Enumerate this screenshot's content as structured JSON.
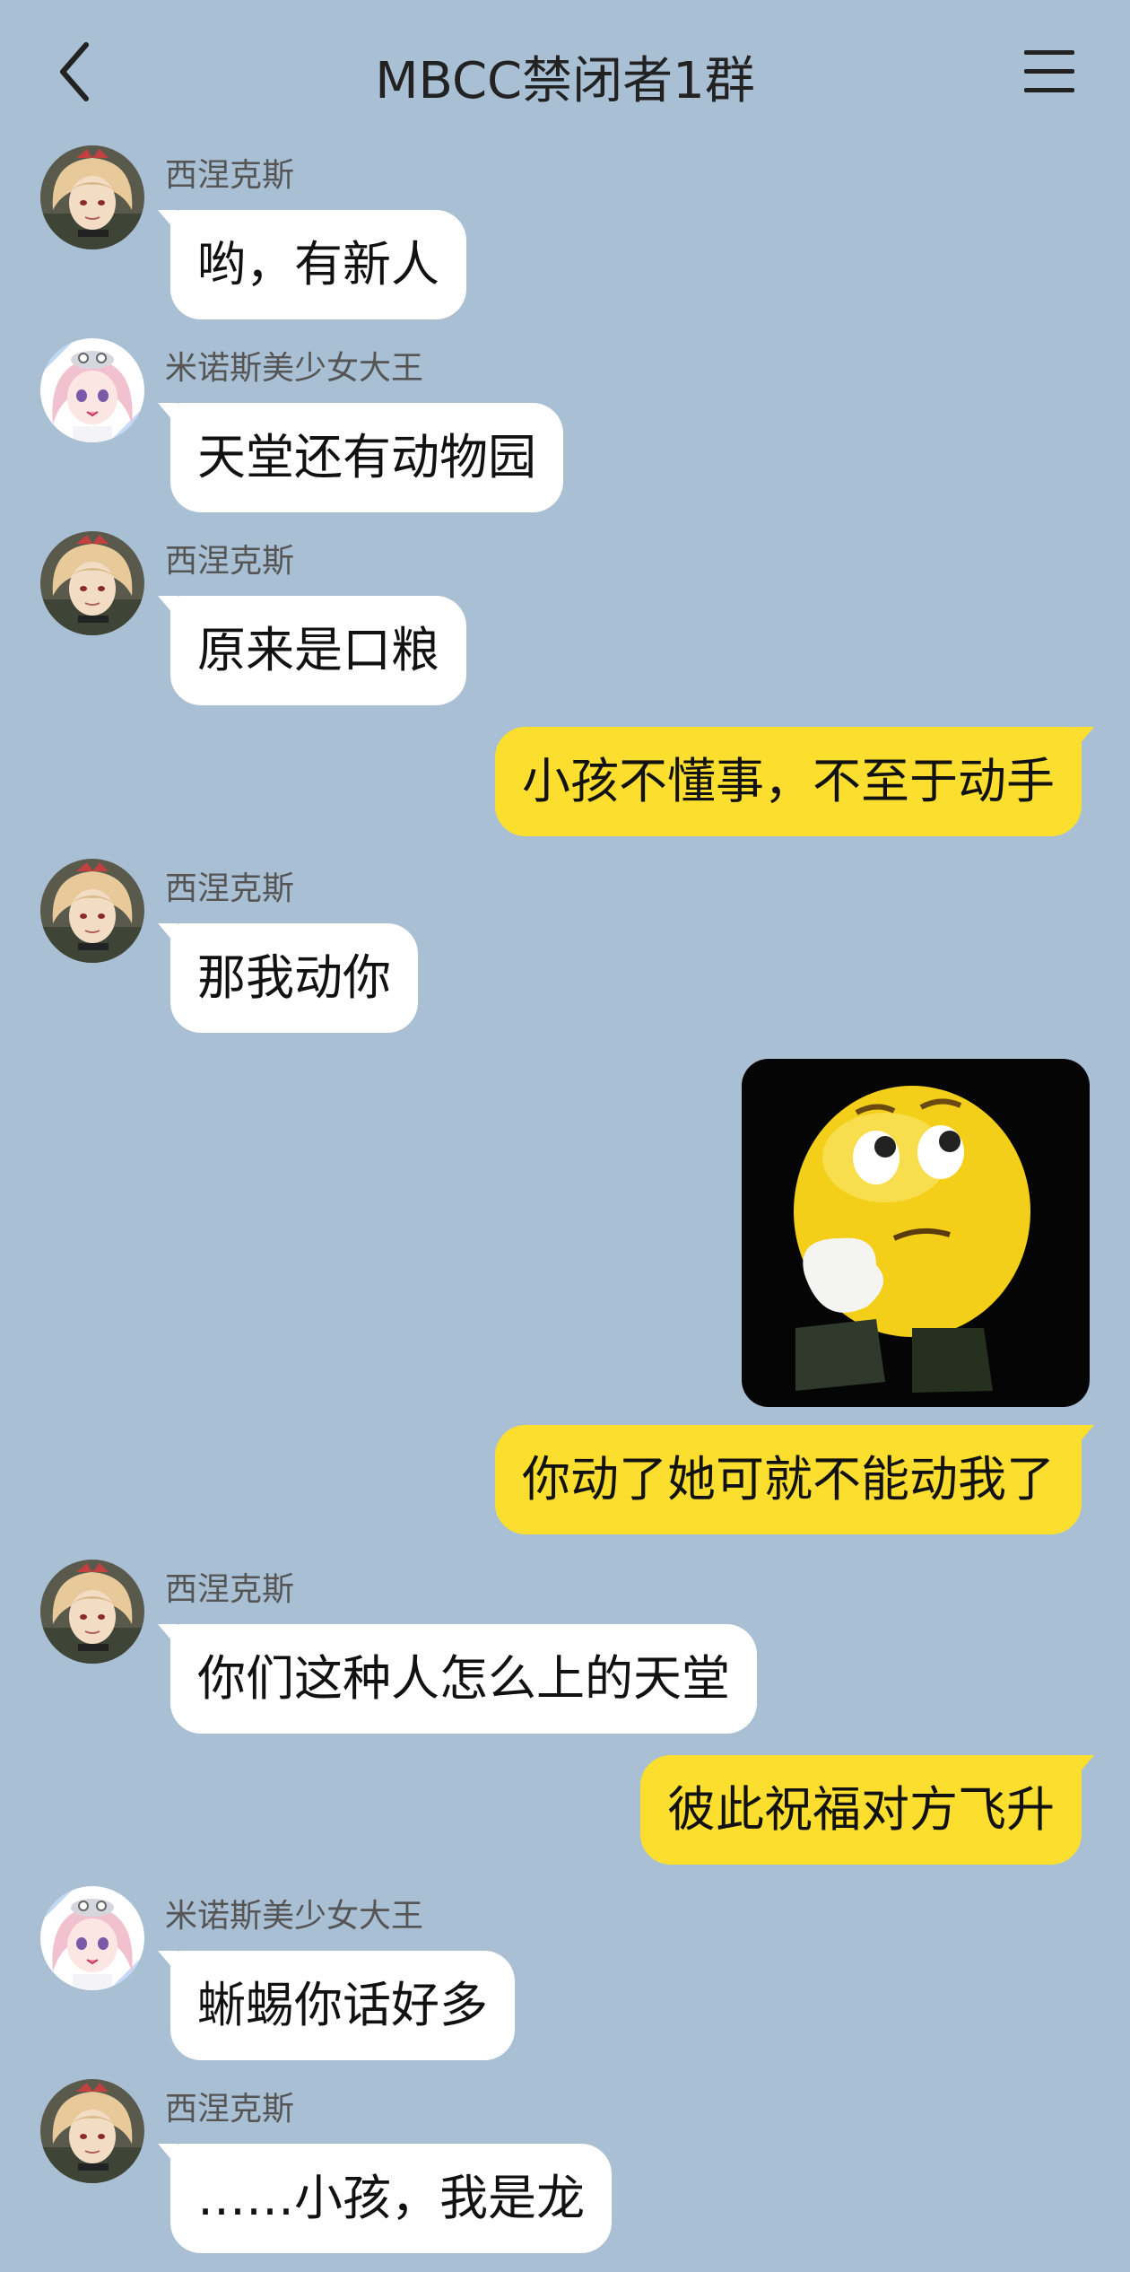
{
  "header": {
    "title": "MBCC禁闭者1群",
    "back_icon": "chevron-left-icon",
    "menu_icon": "hamburger-menu-icon"
  },
  "colors": {
    "background": "#a9bfd3",
    "incoming_bubble": "#ffffff",
    "outgoing_bubble": "#fcde2e"
  },
  "messages": [
    {
      "sender": "西涅克斯",
      "text": "哟，有新人",
      "direction": "in"
    },
    {
      "sender": "米诺斯美少女大王",
      "text": "天堂还有动物园",
      "direction": "in"
    },
    {
      "sender": "西涅克斯",
      "text": "原来是口粮",
      "direction": "in"
    },
    {
      "text": "小孩不懂事，不至于动手",
      "direction": "out"
    },
    {
      "sender": "西涅克斯",
      "text": "那我动你",
      "direction": "in"
    },
    {
      "type": "sticker",
      "sticker": "thinking-emoji-sticker",
      "direction": "out"
    },
    {
      "text": "你动了她可就不能动我了",
      "direction": "out"
    },
    {
      "sender": "西涅克斯",
      "text": "你们这种人怎么上的天堂",
      "direction": "in"
    },
    {
      "text": "彼此祝福对方飞升",
      "direction": "out"
    },
    {
      "sender": "米诺斯美少女大王",
      "text": "蜥蜴你话好多",
      "direction": "in"
    },
    {
      "sender": "西涅克斯",
      "text": "……小孩，我是龙",
      "direction": "in"
    }
  ]
}
